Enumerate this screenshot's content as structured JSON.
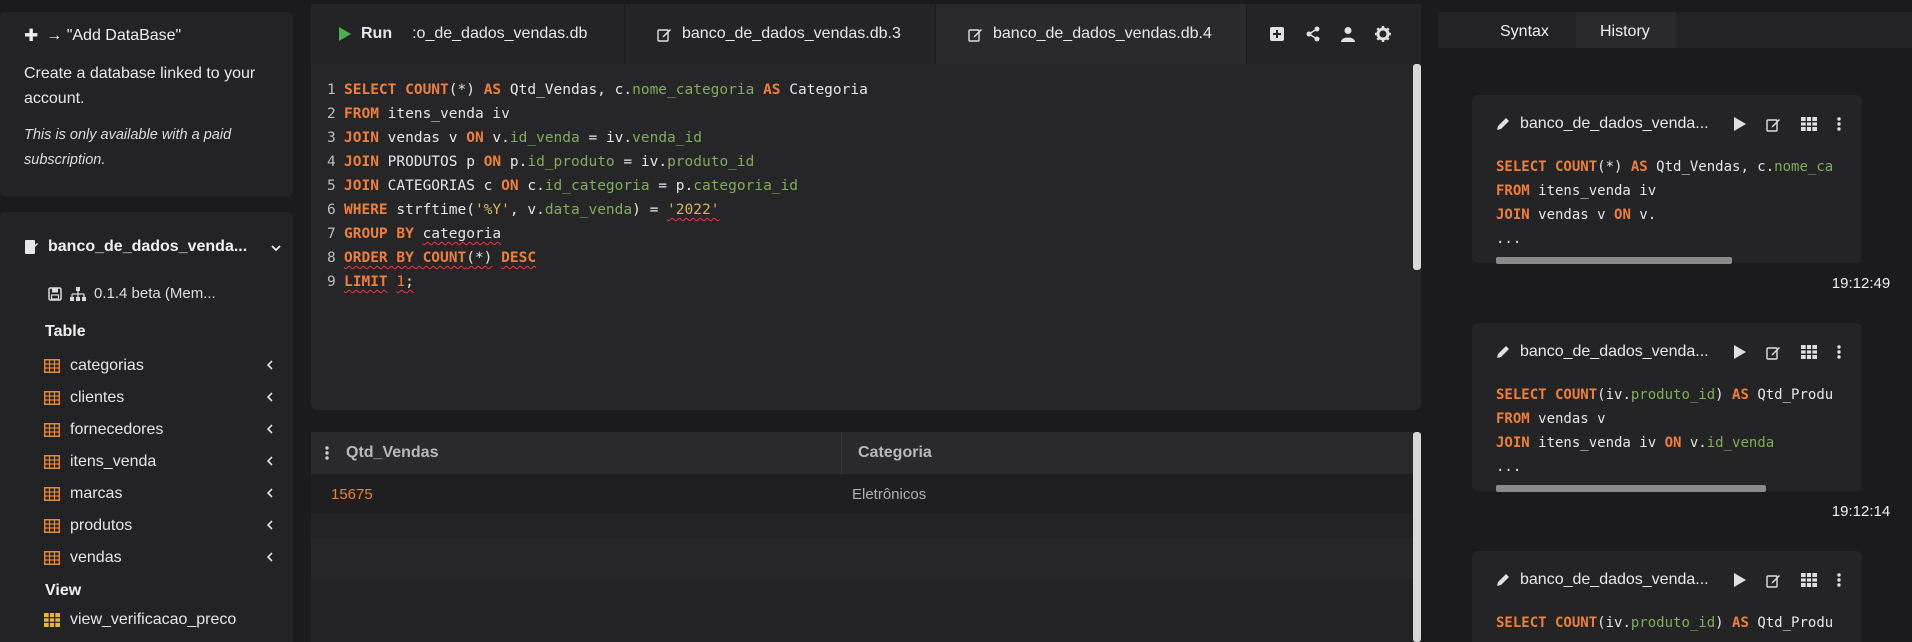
{
  "sidebar": {
    "add_db": {
      "title": "→ \"Add DataBase\"",
      "text": "Create a database linked to your account.",
      "note": "This is only available with a paid subscription."
    },
    "database": {
      "name": "banco_de_dados_venda...",
      "version": "0.1.4 beta (Mem..."
    },
    "table_label": "Table",
    "tables": [
      "categorias",
      "clientes",
      "fornecedores",
      "itens_venda",
      "marcas",
      "produtos",
      "vendas"
    ],
    "view_label": "View",
    "views": [
      "view_verificacao_preco"
    ]
  },
  "editor": {
    "run_label": "Run",
    "tabs": [
      ":o_de_dados_vendas.db",
      "banco_de_dados_vendas.db.3",
      "banco_de_dados_vendas.db.4"
    ],
    "line_numbers": [
      "1",
      "2",
      "3",
      "4",
      "5",
      "6",
      "7",
      "8",
      "9"
    ]
  },
  "results": {
    "columns": [
      "Qtd_Vendas",
      "Categoria"
    ],
    "rows": [
      [
        "15675",
        "Eletrônicos"
      ]
    ]
  },
  "right_panel": {
    "tabs": [
      "Syntax",
      "History"
    ],
    "history": [
      {
        "name": "banco_de_dados_venda...",
        "lines": [
          "SELECT COUNT(*) AS Qtd_Vendas, c.nome_ca",
          "FROM itens_venda iv",
          "JOIN vendas v ON v.",
          "..."
        ],
        "time": "19:12:49"
      },
      {
        "name": "banco_de_dados_venda...",
        "lines": [
          "SELECT COUNT(iv.produto_id) AS Qtd_Produ",
          "FROM vendas v",
          "JOIN itens_venda iv ON v.id_venda",
          "..."
        ],
        "time": "19:12:14"
      },
      {
        "name": "banco_de_dados_venda...",
        "lines": [
          "SELECT COUNT(iv.produto_id) AS Qtd_Produ"
        ],
        "time": ""
      }
    ]
  },
  "colors": {
    "keyword": "#ee7f3c",
    "field": "#7fae5a",
    "string": "#d8b45a",
    "run_green": "#4caf50",
    "db_icon": "#ee7f3c",
    "table_icon": "#e08a3a",
    "view_icon": "#e9b335"
  }
}
